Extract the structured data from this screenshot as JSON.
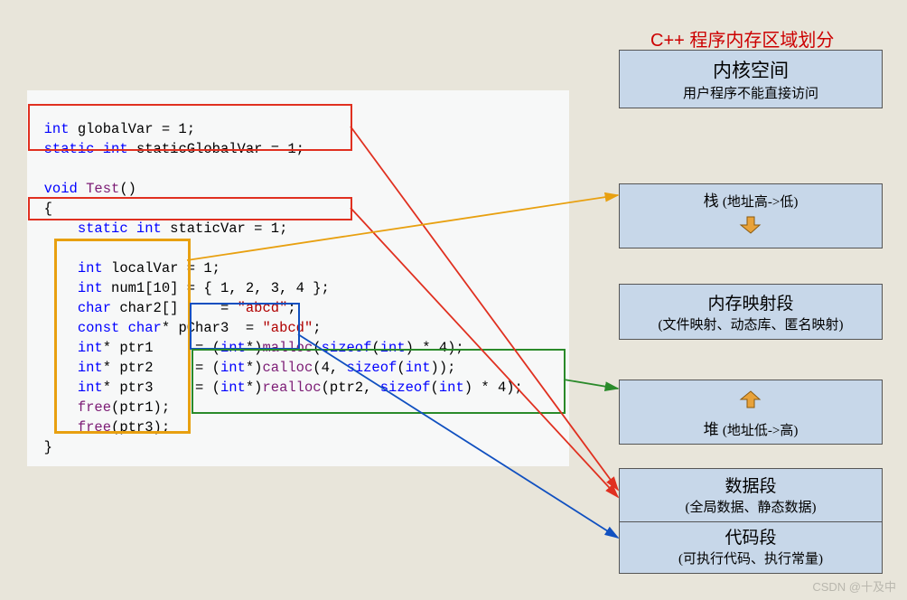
{
  "title": "C++ 程序内存区域划分",
  "code": {
    "line1_kw": "int",
    "line1_rest": " globalVar = 1;",
    "line2_kw1": "static",
    "line2_kw2": " int",
    "line2_rest": " staticGlobalVar = 1;",
    "line3_kw": "void",
    "line3_func": " Test",
    "line3_rest": "()",
    "line4": "{",
    "line5_kw1": "static",
    "line5_kw2": " int",
    "line5_rest": " staticVar = 1;",
    "line6_kw": "int",
    "line6_rest": " localVar = 1;",
    "line7_kw": "int",
    "line7_rest": " num1[10] = { 1, 2, 3, 4 };",
    "line8_kw": "char",
    "line8_a": " char2[]     = ",
    "line8_str": "\"abcd\"",
    "line8_end": ";",
    "line9_kw1": "const",
    "line9_kw2": " char",
    "line9_a": "* pChar3  = ",
    "line9_str": "\"abcd\"",
    "line9_end": ";",
    "line10_kw": "int",
    "line10_a": "* ptr1     = (",
    "line10_cast": "int",
    "line10_b": "*)",
    "line10_fn": "malloc",
    "line10_c": "(",
    "line10_sz": "sizeof",
    "line10_d": "(",
    "line10_t": "int",
    "line10_e": ") * 4);",
    "line11_kw": "int",
    "line11_a": "* ptr2     = (",
    "line11_cast": "int",
    "line11_b": "*)",
    "line11_fn": "calloc",
    "line11_c": "(4, ",
    "line11_sz": "sizeof",
    "line11_d": "(",
    "line11_t": "int",
    "line11_e": "));",
    "line12_kw": "int",
    "line12_a": "* ptr3     = (",
    "line12_cast": "int",
    "line12_b": "*)",
    "line12_fn": "realloc",
    "line12_c": "(ptr2, ",
    "line12_sz": "sizeof",
    "line12_d": "(",
    "line12_t": "int",
    "line12_e": ") * 4);",
    "line13": "free",
    "line13a": "(ptr1);",
    "line14": "free",
    "line14a": "(ptr3);",
    "line15": "}"
  },
  "memory": {
    "kernel": {
      "title": "内核空间",
      "sub": "用户程序不能直接访问"
    },
    "stack": {
      "title": "栈",
      "sub": "(地址高->低)"
    },
    "mmap": {
      "title": "内存映射段",
      "sub": "(文件映射、动态库、匿名映射)"
    },
    "heap": {
      "title": "堆",
      "sub": "(地址低->高)"
    },
    "data": {
      "title": "数据段",
      "sub": "(全局数据、静态数据)"
    },
    "code": {
      "title": "代码段",
      "sub": "(可执行代码、执行常量)"
    }
  },
  "watermark": "CSDN @十及中",
  "annotations": {
    "boxes": {
      "red_globals": {
        "color": "red",
        "maps_to": "数据段"
      },
      "red_staticVar": {
        "color": "red",
        "maps_to": "数据段"
      },
      "orange_locals": {
        "color": "orange",
        "maps_to": "栈"
      },
      "green_heap": {
        "color": "green",
        "maps_to": "堆"
      },
      "blue_literals": {
        "color": "blue",
        "maps_to": "代码段"
      }
    }
  }
}
